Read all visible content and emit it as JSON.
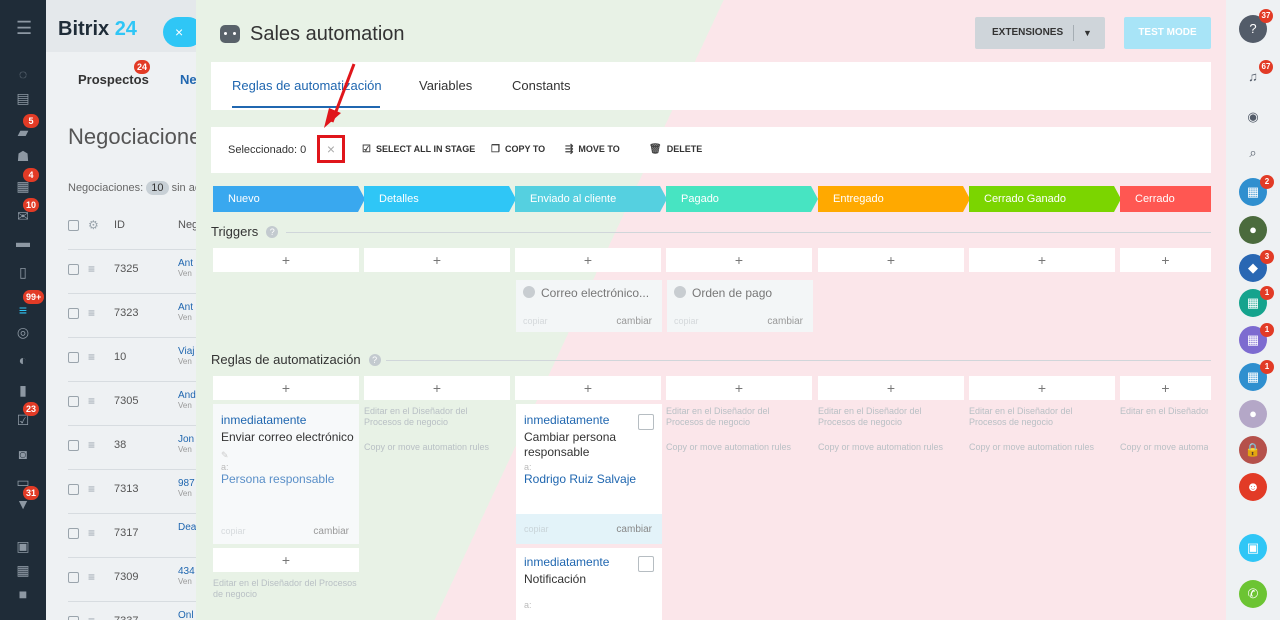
{
  "app": {
    "logo_name": "Bitrix",
    "logo_num": "24"
  },
  "left_rail": {
    "badges": [
      "5",
      "4",
      "10",
      "99+",
      "23",
      "31"
    ]
  },
  "crm_bg": {
    "tabs": [
      {
        "label": "Prospectos",
        "badge": "24"
      },
      {
        "label": "Ne"
      }
    ],
    "title": "Negociaciones",
    "filter_label": "Negociaciones:",
    "filter_count": "10",
    "filter_suffix": "sin ac",
    "col_id": "ID",
    "col_name": "Neg",
    "rows": [
      {
        "id": "7325",
        "name": "Ant",
        "sub": "Ven"
      },
      {
        "id": "7323",
        "name": "Ant",
        "sub": "Ven"
      },
      {
        "id": "10",
        "name": "Viaj",
        "sub": "Ven"
      },
      {
        "id": "7305",
        "name": "And",
        "sub": "Ven"
      },
      {
        "id": "38",
        "name": "Jon",
        "sub": "Ven"
      },
      {
        "id": "7313",
        "name": "987",
        "sub": "Ven"
      },
      {
        "id": "7317",
        "name": "Dea",
        "sub": ""
      },
      {
        "id": "7309",
        "name": "434",
        "sub": "Ven"
      },
      {
        "id": "7337",
        "name": "Onl",
        "sub": ""
      }
    ]
  },
  "slider": {
    "title": "Sales automation",
    "extensions_label": "EXTENSIONES",
    "test_mode_label": "TEST MODE",
    "tabs": [
      "Reglas de automatización",
      "Variables",
      "Constants"
    ]
  },
  "toolbar": {
    "selected": "Seleccionado: 0",
    "clear": "×",
    "select_all": "SELECT ALL IN STAGE",
    "copy_to": "COPY TO",
    "move_to": "MOVE TO",
    "delete": "DELETE"
  },
  "stages": [
    {
      "label": "Nuevo",
      "color": "#39a8ef"
    },
    {
      "label": "Detalles",
      "color": "#2fc6f6"
    },
    {
      "label": "Enviado al cliente",
      "color": "#55d0e0"
    },
    {
      "label": "Pagado",
      "color": "#47e4c2"
    },
    {
      "label": "Entregado",
      "color": "#ffa900"
    },
    {
      "label": "Cerrado Ganado",
      "color": "#7bd500"
    },
    {
      "label": "Cerrado Perdido",
      "color": "#ff5752"
    }
  ],
  "triggers": {
    "title": "Triggers",
    "help": "?",
    "plus": "+",
    "items": [
      {
        "name": "Correo electrónico...",
        "copy": "copiar",
        "change": "cambiar"
      },
      {
        "name": "Orden de pago",
        "copy": "copiar",
        "change": "cambiar"
      }
    ]
  },
  "rules": {
    "title": "Reglas de automatización",
    "help": "?",
    "plus": "+",
    "empty_edit": "Editar en el Diseñador del Procesos de negocio",
    "empty_copy": "Copy or move automation rules",
    "col1": {
      "when": "inmediatamente",
      "action": "Enviar correo electrónico",
      "to_label": "a:",
      "to": "Persona responsable",
      "copy": "copiar",
      "change": "cambiar"
    },
    "col3_a": {
      "when": "inmediatamente",
      "action": "Cambiar persona responsable",
      "to_label": "a:",
      "to": "Rodrigo Ruiz Salvaje",
      "copy": "copiar",
      "change": "cambiar"
    },
    "col3_b": {
      "when": "inmediatamente",
      "action": "Notificación",
      "to_label": "a:"
    }
  },
  "right_rail": {
    "badges": [
      "37",
      "67",
      "2",
      "3",
      "1",
      "1",
      "1"
    ]
  }
}
